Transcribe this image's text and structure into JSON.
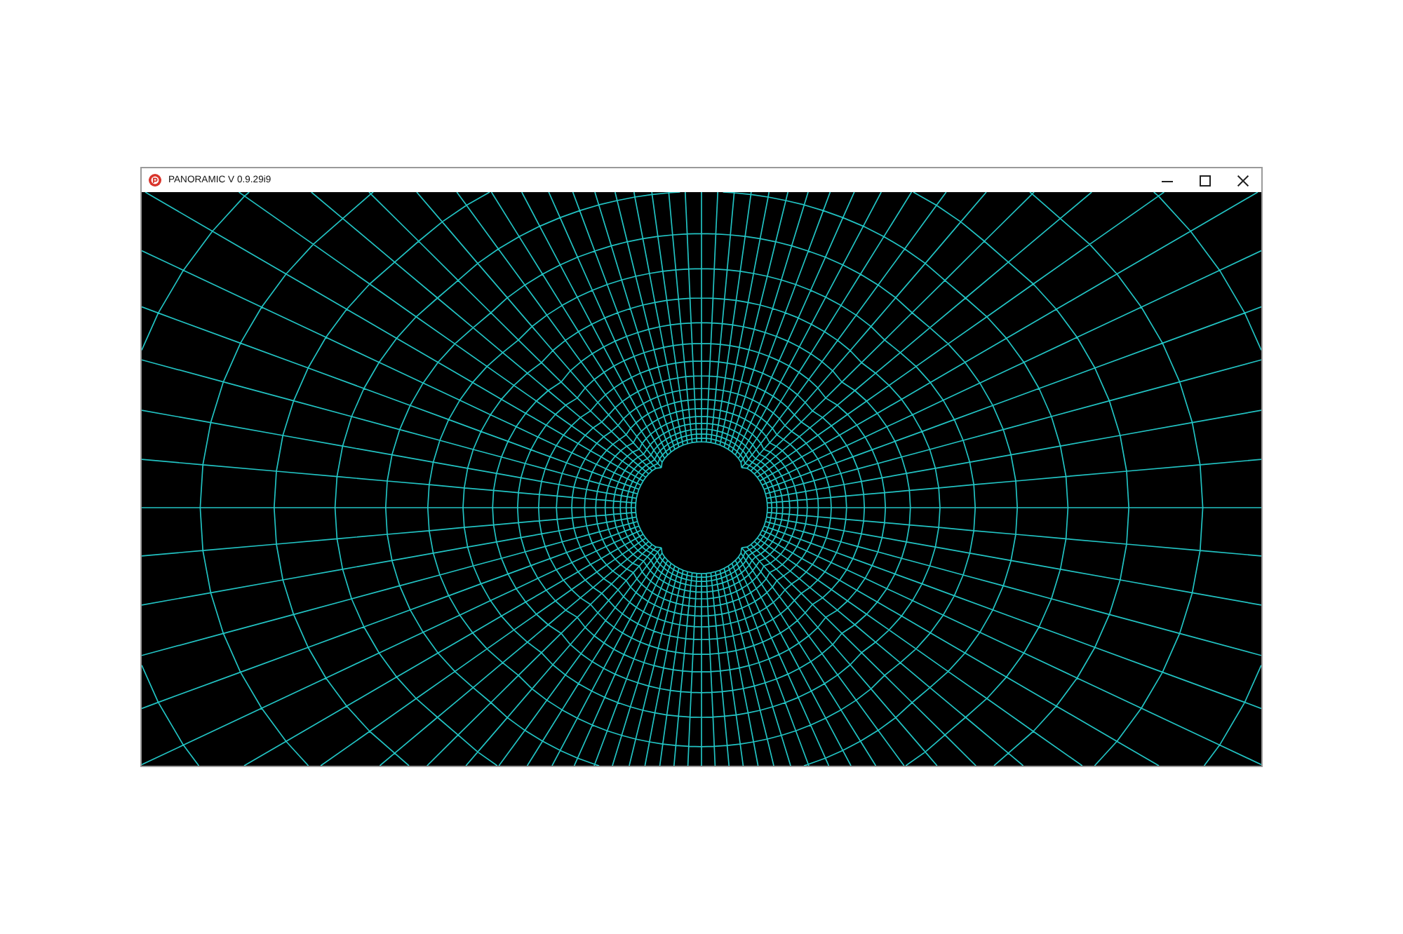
{
  "window": {
    "title": "PANORAMIC V 0.9.29i9"
  }
}
